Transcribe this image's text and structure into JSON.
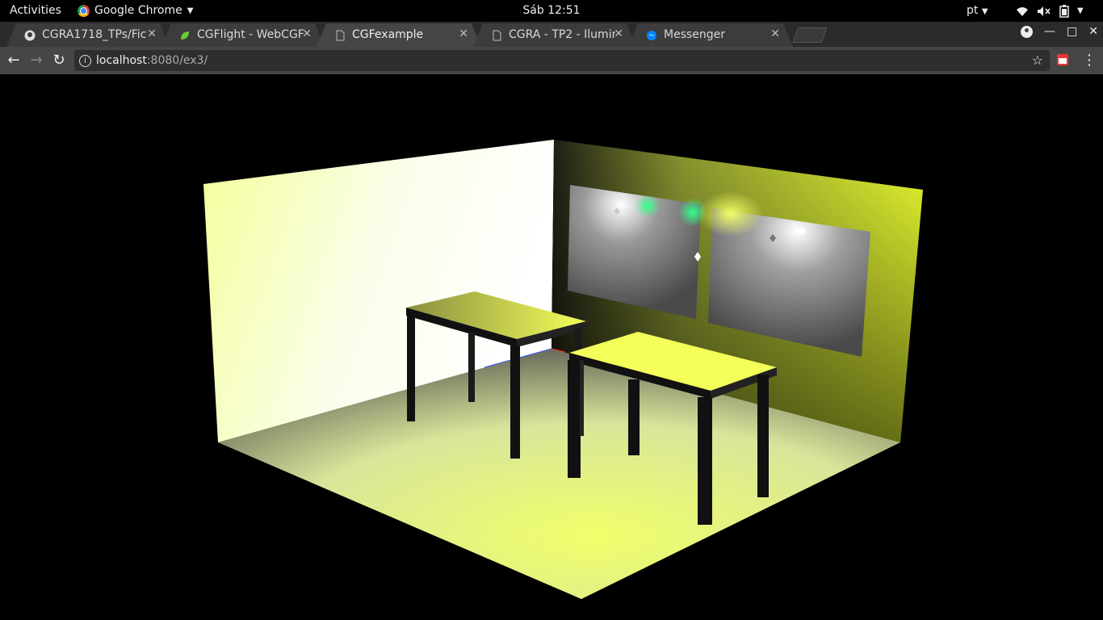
{
  "topbar": {
    "activities": "Activities",
    "app_name": "Google Chrome",
    "clock": "Sáb 12:51",
    "language": "pt"
  },
  "tabs": [
    {
      "title": "CGRA1718_TPs/Fic",
      "icon": "github-icon",
      "active": false
    },
    {
      "title": "CGFlight - WebCGF",
      "icon": "leaf-icon",
      "active": false
    },
    {
      "title": "CGFexample",
      "icon": "page-icon",
      "active": true
    },
    {
      "title": "CGRA - TP2 - Ilumin",
      "icon": "page-icon",
      "active": false
    },
    {
      "title": "Messenger",
      "icon": "messenger-icon",
      "active": false
    }
  ],
  "address_bar": {
    "host": "localhost",
    "path": ":8080/ex3/"
  },
  "scene": {
    "description_colors": {
      "wall_light": "#ffffd0",
      "wall_yellow": "#e6ff33",
      "floor_center": "#f0ff70",
      "table_top": "#f4ff5a",
      "table_leg": "#111111"
    }
  }
}
